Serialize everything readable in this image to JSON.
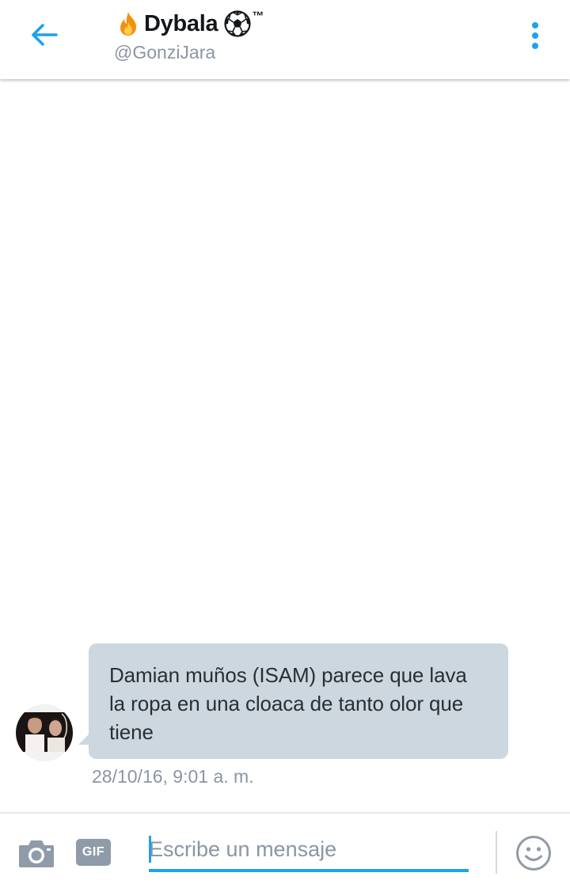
{
  "header": {
    "back_icon": "arrow-left-icon",
    "display_name": "Dybala",
    "name_prefix_icon": "fire-emoji-icon",
    "name_suffix_icon": "soccer-ball-emoji-icon",
    "name_suffix_text": "™",
    "handle": "@GonziJara",
    "menu_icon": "more-vertical-icon"
  },
  "conversation": {
    "messages": [
      {
        "sender": "received",
        "text": "Damian muños (ISAM) parece que lava la ropa en una cloaca de tanto olor que tiene",
        "timestamp": "28/10/16, 9:01 a. m."
      }
    ]
  },
  "composer": {
    "camera_icon": "camera-icon",
    "gif_label": "GIF",
    "input_placeholder": "Escribe un mensaje",
    "input_value": "",
    "emoji_icon": "smiley-icon"
  },
  "colors": {
    "accent": "#1da1f2",
    "bubble_received": "#cdd7df",
    "secondary_text": "#8a96a3",
    "primary_text": "#14171a"
  }
}
